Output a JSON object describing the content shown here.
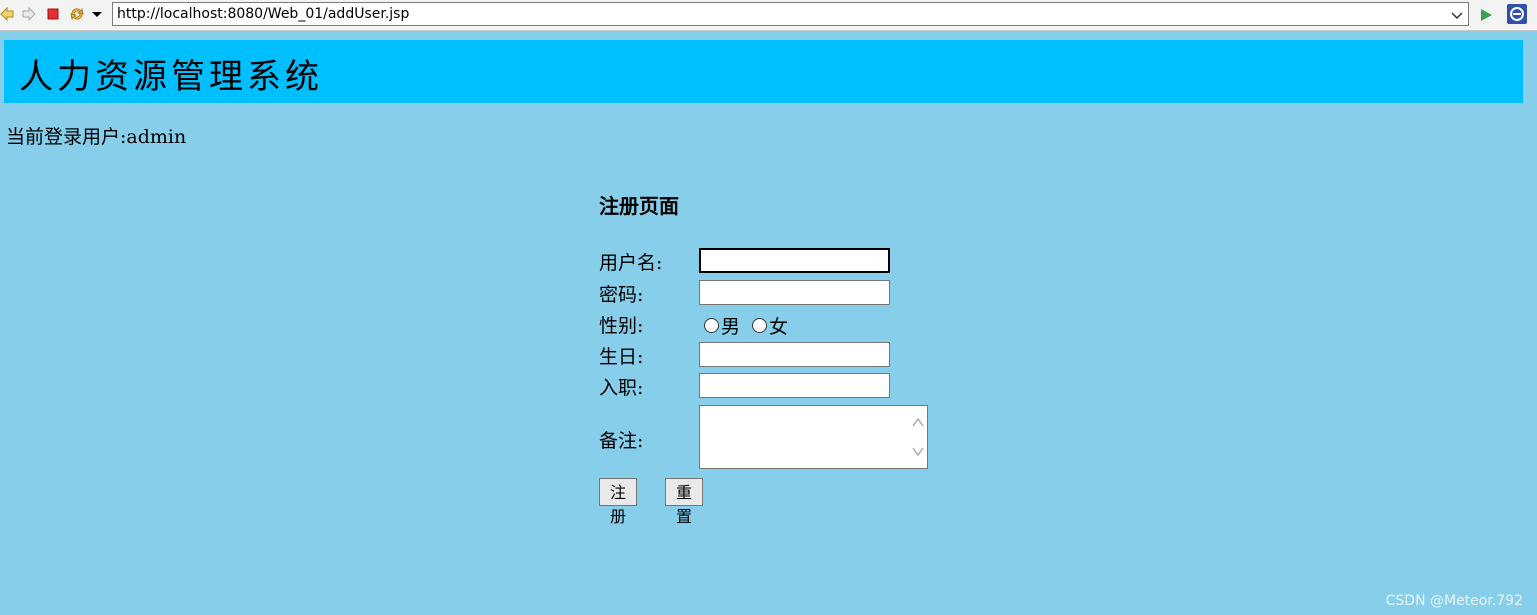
{
  "browser": {
    "url": "http://localhost:8080/Web_01/addUser.jsp",
    "icons": [
      "back-icon",
      "forward-icon",
      "stop-icon",
      "refresh-icon",
      "dropdown-icon",
      "url-dropdown-icon",
      "go-icon",
      "extension-icon"
    ]
  },
  "header": {
    "title": "人力资源管理系统"
  },
  "user": {
    "login_text": "当前登录用户:admin"
  },
  "form": {
    "title": "注册页面",
    "username_label": "用户名:",
    "password_label": "密码:",
    "gender_label": "性别:",
    "gender_options": [
      "男",
      "女"
    ],
    "birthday_label": "生日:",
    "hire_label": "入职:",
    "remark_label": "备注:",
    "username_value": "",
    "password_value": "",
    "birthday_value": "",
    "hire_value": "",
    "remark_value": "",
    "submit_label": "注册",
    "reset_label": "重置"
  },
  "watermark": "CSDN @Meteor.792",
  "colors": {
    "page_bg": "#87CEEB",
    "banner_bg": "#00BFFF"
  }
}
